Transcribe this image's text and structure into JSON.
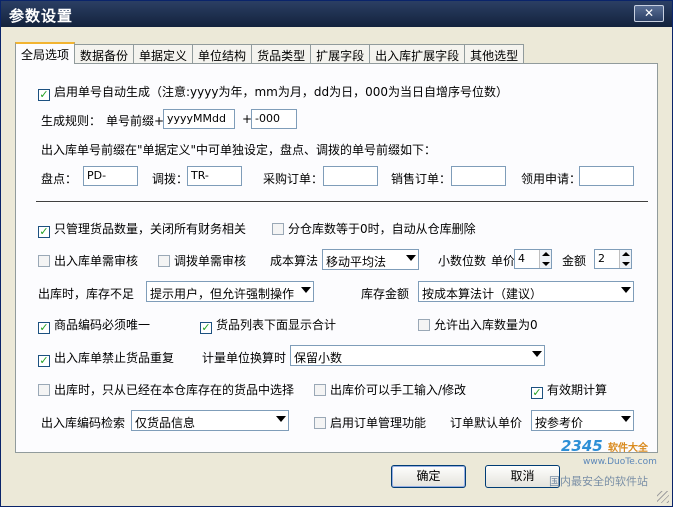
{
  "window": {
    "title": "参数设置",
    "close_glyph": "✕"
  },
  "tabs": [
    {
      "label": "全局选项",
      "active": true
    },
    {
      "label": "数据备份"
    },
    {
      "label": "单据定义"
    },
    {
      "label": "单位结构"
    },
    {
      "label": "货品类型"
    },
    {
      "label": "扩展字段"
    },
    {
      "label": "出入库扩展字段"
    },
    {
      "label": "其他选型"
    }
  ],
  "general": {
    "auto_number_label": "启用单号自动生成（注意:yyyy为年，mm为月，dd为日，000为当日自增序号位数）",
    "auto_number_checked": true,
    "rule_label": "生成规则：",
    "prefix_label": "单号前缀+",
    "prefix_value": "yyyyMMdd",
    "plus_label": "+",
    "suffix_value": "-000",
    "note": "出入库单号前缀在\"单据定义\"中可单独设定，盘点、调拨的单号前缀如下：",
    "pd_label": "盘点：",
    "pd_value": "PD-",
    "tb_label": "调拨：",
    "tb_value": "TR-",
    "cg_label": "采购订单：",
    "cg_value": "",
    "xs_label": "销售订单：",
    "xs_value": "",
    "ly_label": "领用申请：",
    "ly_value": ""
  },
  "options": {
    "only_qty": "只管理货品数量，关闭所有财务相关",
    "auto_delete": "分仓库数等于0时，自动从仓库删除",
    "inout_review": "出入库单需审核",
    "transfer_review": "调拨单需审核",
    "cost_method_label": "成本算法",
    "cost_method_value": "移动平均法",
    "decimals_label": "小数位数",
    "price_label": "单价",
    "price_decimals": "4",
    "amount_label": "金额",
    "amount_decimals": "2",
    "shortage_label": "出库时，库存不足",
    "shortage_value": "提示用户，但允许强制操作",
    "stock_amount_label": "库存金额",
    "stock_amount_value": "按成本算法计（建议）",
    "unique_code": "商品编码必须唯一",
    "show_total": "货品列表下面显示合计",
    "allow_inout_zero": "允许出入库数量为0",
    "no_duplicate": "出入库单禁止货品重复",
    "unit_convert_label": "计量单位换算时",
    "unit_convert_value": "保留小数",
    "stock_select": "出库时，只从已经在本仓库存在的货品中选择",
    "manual_price": "出库价可以手工输入/修改",
    "expiry_calc": "有效期计算",
    "code_search_label": "出入库编码检索",
    "code_search_value": "仅货品信息",
    "order_mgmt": "启用订单管理功能",
    "order_price_label": "订单默认单价",
    "order_price_value": "按参考价"
  },
  "buttons": {
    "ok": "确定",
    "cancel": "取消"
  },
  "watermark": {
    "brand": "2345",
    "brand_sub": "软件大全",
    "site": "www.DuoTe.com",
    "slogan": "国内最安全的软件站"
  },
  "colors": {
    "title_bar": "#1f3050",
    "tab_active_accent": "#f2b431",
    "check_green": "#21a121"
  }
}
